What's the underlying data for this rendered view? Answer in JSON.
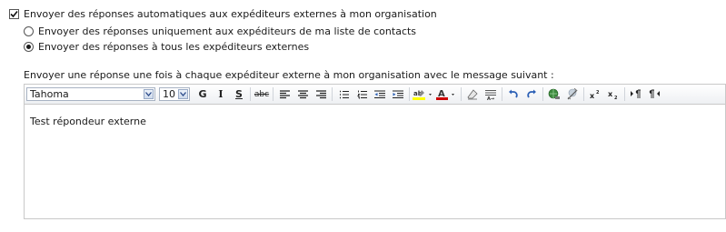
{
  "options": {
    "external_checkbox_label": "Envoyer des réponses automatiques aux expéditeurs externes à mon organisation",
    "radio_contacts_label": "Envoyer des réponses uniquement aux expéditeurs de ma liste de contacts",
    "radio_all_label": "Envoyer des réponses à tous les expéditeurs externes",
    "external_enabled": true,
    "selected_radio": "all"
  },
  "message_label": "Envoyer une réponse une fois à chaque expéditeur externe à mon organisation avec le message suivant :",
  "editor": {
    "font_family": "Tahoma",
    "font_size": "10",
    "bold_label": "G",
    "italic_label": "I",
    "underline_label": "S",
    "strike_label": "abc",
    "content": "Test répondeur externe",
    "highlight_color": "#ffff00",
    "font_color": "#cc0000",
    "icons": [
      "bold-icon",
      "italic-icon",
      "underline-icon",
      "strikethrough-icon",
      "align-left-icon",
      "align-center-icon",
      "align-right-icon",
      "bulleted-list-icon",
      "numbered-list-icon",
      "decrease-indent-icon",
      "increase-indent-icon",
      "highlight-icon",
      "font-color-icon",
      "eraser-icon",
      "clear-format-icon",
      "undo-icon",
      "redo-icon",
      "insert-link-icon",
      "remove-link-icon",
      "superscript-icon",
      "subscript-icon",
      "ltr-icon",
      "rtl-icon"
    ]
  }
}
